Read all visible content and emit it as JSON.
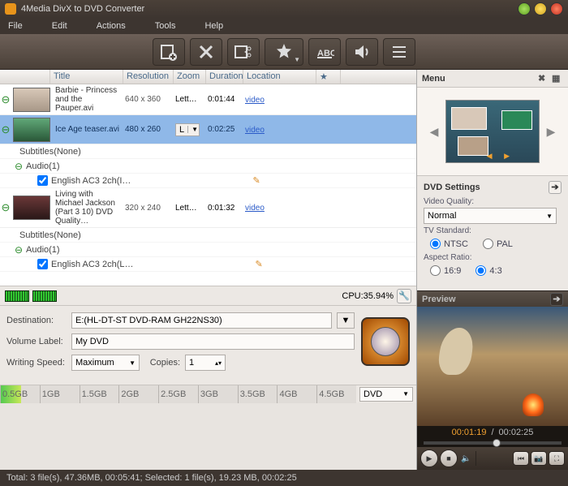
{
  "titlebar": {
    "title": "4Media DivX to DVD Converter"
  },
  "menubar": [
    "File",
    "Edit",
    "Actions",
    "Tools",
    "Help"
  ],
  "toolbar": [
    {
      "name": "add-file",
      "icon": "film-plus"
    },
    {
      "name": "delete",
      "icon": "x"
    },
    {
      "name": "clip",
      "icon": "film-scissors"
    },
    {
      "name": "effects",
      "icon": "star",
      "dropdown": true
    },
    {
      "name": "subtitle",
      "icon": "abc"
    },
    {
      "name": "audio",
      "icon": "speaker"
    },
    {
      "name": "chapter",
      "icon": "list"
    }
  ],
  "columns": {
    "title": "Title",
    "resolution": "Resolution",
    "zoom": "Zoom",
    "duration": "Duration",
    "location": "Location",
    "star": "★"
  },
  "files": [
    {
      "title": "Barbie - Princess and the Pauper.avi",
      "res": "640 x 360",
      "zoom": "Lett…",
      "dur": "0:01:44",
      "loc": "video",
      "selected": false,
      "subtitles": "Subtitles(None)",
      "audio_hdr": "Audio(1)",
      "tracks": [
        "English AC3 2ch(I…"
      ]
    },
    {
      "title": "Ice Age teaser.avi",
      "res": "480 x 260",
      "zoom": "L",
      "dur": "0:02:25",
      "loc": "video",
      "selected": true,
      "subtitles": "",
      "audio_hdr": "",
      "tracks": []
    },
    {
      "title": "Living with Michael Jackson (Part 3 10) DVD Quality…",
      "res": "320 x 240",
      "zoom": "Lett…",
      "dur": "0:01:32",
      "loc": "video",
      "selected": false,
      "subtitles": "Subtitles(None)",
      "audio_hdr": "Audio(1)",
      "tracks": [
        "English AC3 2ch(L…"
      ]
    }
  ],
  "cpu": {
    "label": "CPU:35.94%"
  },
  "dest": {
    "destination_label": "Destination:",
    "destination_value": "E:(HL-DT-ST DVD-RAM GH22NS30)",
    "volume_label": "Volume Label:",
    "volume_value": "My DVD",
    "speed_label": "Writing Speed:",
    "speed_value": "Maximum",
    "copies_label": "Copies:",
    "copies_value": "1"
  },
  "sizebar": {
    "ticks": [
      "0.5GB",
      "1GB",
      "1.5GB",
      "2GB",
      "2.5GB",
      "3GB",
      "3.5GB",
      "4GB",
      "4.5GB"
    ],
    "target": "DVD"
  },
  "status": "Total: 3 file(s), 47.36MB, 00:05:41; Selected: 1 file(s), 19.23 MB, 00:02:25",
  "rightMenu": {
    "title": "Menu"
  },
  "dvdSettings": {
    "header": "DVD Settings",
    "quality_label": "Video Quality:",
    "quality_value": "Normal",
    "tv_label": "TV Standard:",
    "tv_ntsc": "NTSC",
    "tv_pal": "PAL",
    "tv_selected": "NTSC",
    "aspect_label": "Aspect Ratio:",
    "aspect_169": "16:9",
    "aspect_43": "4:3",
    "aspect_selected": "4:3"
  },
  "preview": {
    "header": "Preview",
    "time_current": "00:01:19",
    "time_total": "00:02:25"
  }
}
